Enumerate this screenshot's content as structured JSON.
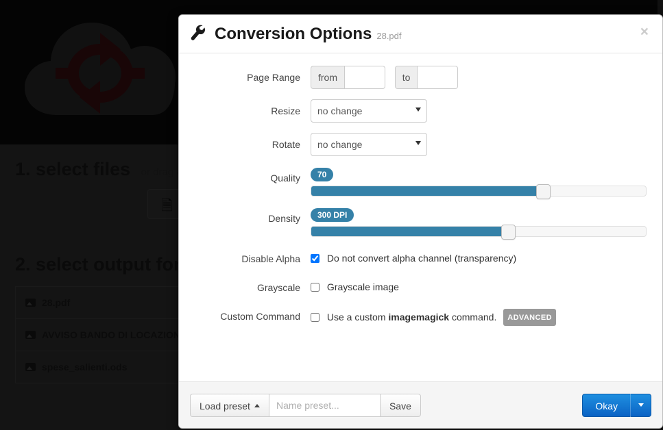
{
  "background": {
    "logo_icon": "cloud-sync-icon",
    "section1": {
      "number": "1.",
      "title": "select files",
      "subtitle": "or drag & drop"
    },
    "section2": {
      "number": "2.",
      "title": "select output form"
    },
    "select_files_icon": "add-file-icon",
    "files": [
      {
        "icon": "image-file-icon",
        "name": "28.pdf"
      },
      {
        "icon": "image-file-icon",
        "name": "AVVISO BANDO DI LOCAZIONE"
      },
      {
        "icon": "image-file-icon",
        "name": "spese_salienti.ods"
      }
    ]
  },
  "modal": {
    "icon": "wrench-icon",
    "title": "Conversion Options",
    "subtitle": "28.pdf",
    "close_label": "×",
    "rows": {
      "page_range": {
        "label": "Page Range",
        "from_addon": "from",
        "from_value": "",
        "from_placeholder": "",
        "to_addon": "to",
        "to_value": "",
        "to_placeholder": ""
      },
      "resize": {
        "label": "Resize",
        "value": "no change",
        "options": [
          "no change"
        ]
      },
      "rotate": {
        "label": "Rotate",
        "value": "no change",
        "options": [
          "no change"
        ]
      },
      "quality": {
        "label": "Quality",
        "badge": "70",
        "value": 70,
        "min": 0,
        "max": 100,
        "fill_percent": 70,
        "accent": "#3581a8"
      },
      "density": {
        "label": "Density",
        "badge": "300 DPI",
        "value": 300,
        "min": 0,
        "max": 600,
        "fill_percent": 59,
        "accent": "#3581a8"
      },
      "disable_alpha": {
        "label": "Disable Alpha",
        "checkbox_text": "Do not convert alpha channel (transparency)",
        "checked": true
      },
      "grayscale": {
        "label": "Grayscale",
        "checkbox_text": "Grayscale image",
        "checked": false
      },
      "custom_command": {
        "label": "Custom Command",
        "text_before": "Use a custom ",
        "text_bold": "imagemagick",
        "text_after": " command.",
        "badge": "ADVANCED",
        "badge_color": "#999999",
        "checked": false
      }
    },
    "footer": {
      "load_preset_label": "Load preset",
      "load_preset_caret": "caret-up-icon",
      "preset_name_value": "",
      "preset_name_placeholder": "Name preset...",
      "save_label": "Save",
      "okay_label": "Okay",
      "okay_caret": "caret-down-icon",
      "primary_color": "#0b63c4"
    }
  }
}
